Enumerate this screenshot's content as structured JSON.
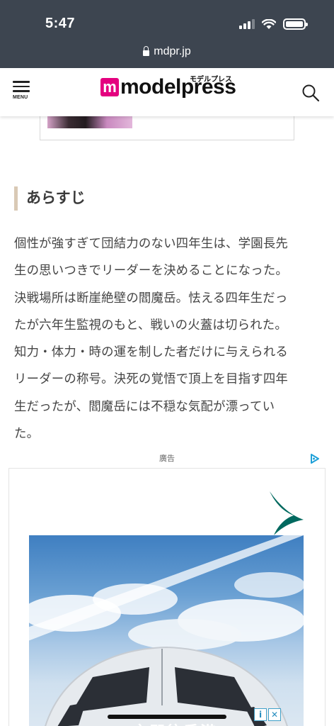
{
  "status_bar": {
    "time": "5:47"
  },
  "browser": {
    "url": "mdpr.jp"
  },
  "header": {
    "menu_label": "MENU",
    "logo_text": "modelpress",
    "logo_kana": "モデルプレス",
    "logo_letter": "m"
  },
  "section": {
    "title": "あらすじ",
    "synopsis_lines": [
      "個性が強すぎて団結力のない四年生は、学園長先",
      "生の思いつきでリーダーを決めることになった。",
      "決戦場所は断崖絶壁の閻魔岳。怯える四年生だっ",
      "たが六年生監視のもと、戦いの火蓋は切られた。",
      "知力・体力・時の運を制した者だけに与えられる",
      "リーダーの称号。決死の覚悟で頂上を目指す四年",
      "生だったが、閻魔岳には不穏な気配が漂ってい",
      "た。"
    ]
  },
  "ad": {
    "label": "廣告",
    "info_icon": "i",
    "close_icon": "✕",
    "partial_text": "一言即往香港"
  },
  "colors": {
    "browser_bar": "#3d4550",
    "brand_pink": "#e4007f",
    "heading_accent": "#d9c9b5",
    "ad_brand_teal": "#00695f"
  }
}
